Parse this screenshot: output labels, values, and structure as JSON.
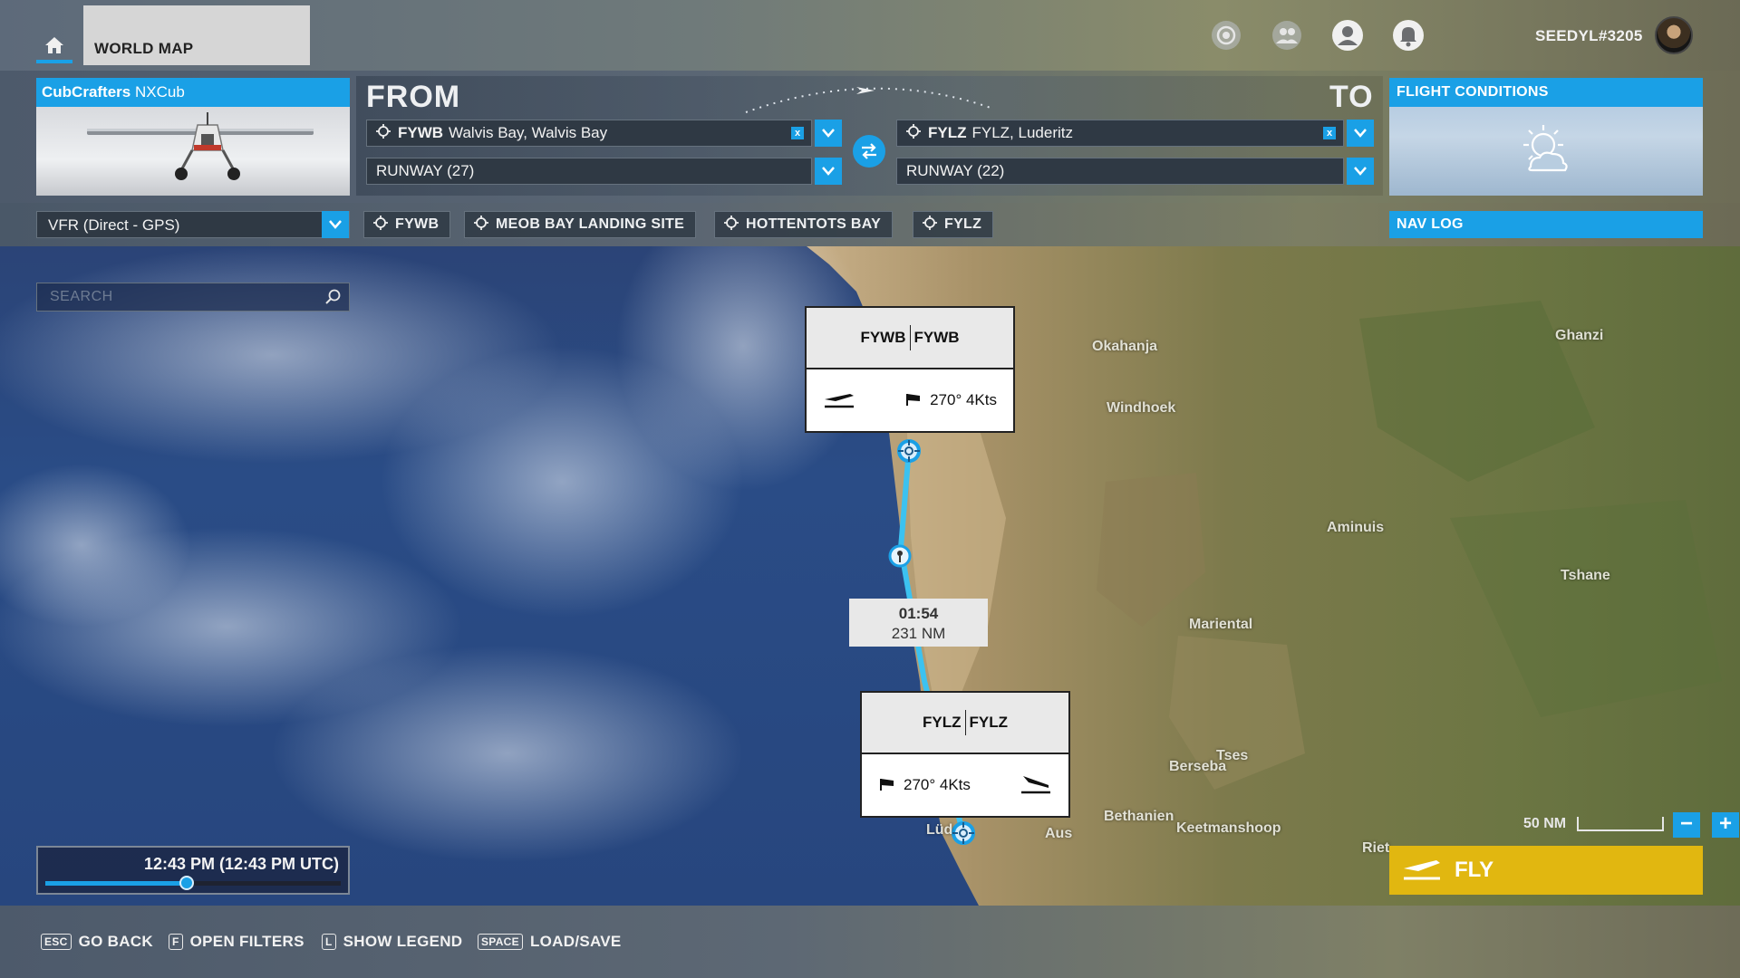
{
  "topbar": {
    "tab_title": "WORLD MAP",
    "username": "SEEDYL#3205",
    "icons": [
      "home-icon",
      "achievements-icon",
      "friends-icon",
      "profile-icon",
      "notifications-icon"
    ]
  },
  "aircraft": {
    "brand": "CubCrafters",
    "model": "NXCub"
  },
  "route": {
    "from_label": "FROM",
    "to_label": "TO",
    "departure": {
      "code": "FYWB",
      "name": "Walvis Bay, Walvis Bay",
      "runway": "RUNWAY (27)"
    },
    "arrival": {
      "code": "FYLZ",
      "name": "FYLZ, Luderitz",
      "runway": "RUNWAY (22)"
    },
    "clear_symbol": "x"
  },
  "conditions": {
    "title": "FLIGHT CONDITIONS"
  },
  "flight_plan": {
    "type": "VFR (Direct - GPS)",
    "waypoints": [
      "FYWB",
      "MEOB BAY LANDING SITE",
      "HOTTENTOTS BAY",
      "FYLZ"
    ],
    "navlog_label": "NAV LOG"
  },
  "map": {
    "search_placeholder": "SEARCH",
    "departure_card": {
      "code_left": "FYWB",
      "code_right": "FYWB",
      "wind": "270° 4Kts"
    },
    "arrival_card": {
      "code_left": "FYLZ",
      "code_right": "FYLZ",
      "wind": "270° 4Kts"
    },
    "leg": {
      "time": "01:54",
      "distance": "231 NM"
    },
    "cities": [
      "Okahanja",
      "Windhoek",
      "Ghanzi",
      "Aminuis",
      "Tshane",
      "Mariental",
      "Tses",
      "Berseba",
      "Bethanien",
      "Keetmanshoop",
      "Aus",
      "Lüd",
      "Riet"
    ],
    "scale_label": "50 NM",
    "zoom_out": "−",
    "zoom_in": "+"
  },
  "time": {
    "label": "12:43 PM (12:43 PM UTC)",
    "progress": 0.48
  },
  "fly_label": "FLY",
  "bottom_hints": [
    {
      "key": "ESC",
      "label": "GO BACK"
    },
    {
      "key": "F",
      "label": "OPEN FILTERS"
    },
    {
      "key": "L",
      "label": "SHOW LEGEND"
    },
    {
      "key": "SPACE",
      "label": "LOAD/SAVE"
    }
  ],
  "colors": {
    "accent": "#1aa0e6",
    "fly_button": "#e1b710",
    "route_line": "#3cc2f0",
    "ocean": "#2a4c86"
  }
}
